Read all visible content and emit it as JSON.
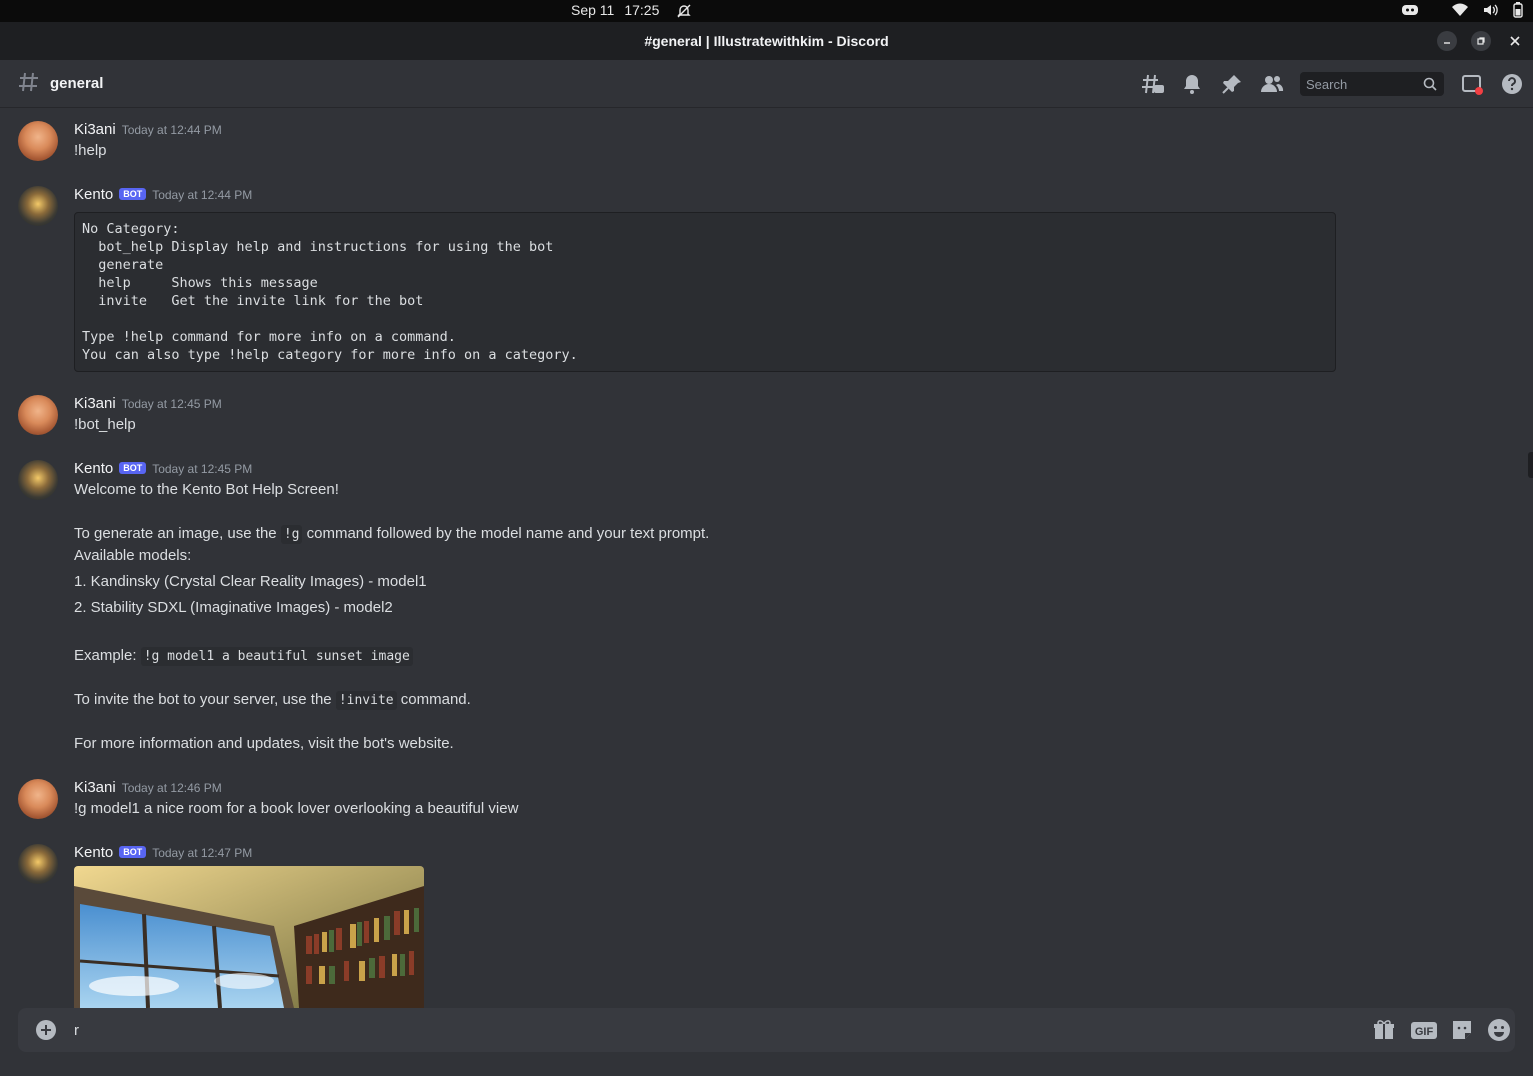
{
  "os_bar": {
    "date": "Sep 11",
    "time": "17:25"
  },
  "window": {
    "title": "#general | Illustratewithkim - Discord"
  },
  "channel": {
    "name": "general"
  },
  "search": {
    "placeholder": "Search"
  },
  "messages": [
    {
      "author": "Ki3ani",
      "timestamp": "Today at 12:44 PM",
      "text": "!help"
    },
    {
      "author": "Kento",
      "bot_tag": "BOT",
      "timestamp": "Today at 12:44 PM",
      "code": "No Category:\n  bot_help Display help and instructions for using the bot\n  generate\n  help     Shows this message\n  invite   Get the invite link for the bot\n\nType !help command for more info on a command.\nYou can also type !help category for more info on a category."
    },
    {
      "author": "Ki3ani",
      "timestamp": "Today at 12:45 PM",
      "text": "!bot_help"
    },
    {
      "author": "Kento",
      "bot_tag": "BOT",
      "timestamp": "Today at 12:45 PM",
      "welcome": "Welcome to the Kento Bot Help Screen!",
      "gen_pre": "To generate an image, use the ",
      "gen_code": "!g",
      "gen_post": " command followed by the model name and your text prompt.",
      "models_heading": "Available models:",
      "model1": "1. Kandinsky (Crystal Clear Reality Images) - model1",
      "model2": "2. Stability SDXL (Imaginative Images) - model2",
      "example_label": "Example: ",
      "example_code": "!g model1 a beautiful sunset image",
      "invite_pre": "To invite the bot to your server, use the ",
      "invite_code": "!invite",
      "invite_post": " command.",
      "more_info": "For more information and updates, visit the bot's website."
    },
    {
      "author": "Ki3ani",
      "timestamp": "Today at 12:46 PM",
      "text": "!g model1 a nice room for a book lover overlooking a beautiful view"
    },
    {
      "author": "Kento",
      "bot_tag": "BOT",
      "timestamp": "Today at 12:47 PM"
    }
  ],
  "composer": {
    "value": "r"
  },
  "icons": {
    "header": [
      "threads-icon",
      "bell-icon",
      "pin-icon",
      "members-icon",
      "search-icon",
      "inbox-icon",
      "help-icon"
    ],
    "composer": [
      "add-circle-icon",
      "gift-icon",
      "gif-icon",
      "sticker-icon",
      "emoji-icon"
    ]
  },
  "colors": {
    "background": "#313338",
    "bot_tag": "#5865f2",
    "inbox_badge": "#f23f43"
  }
}
